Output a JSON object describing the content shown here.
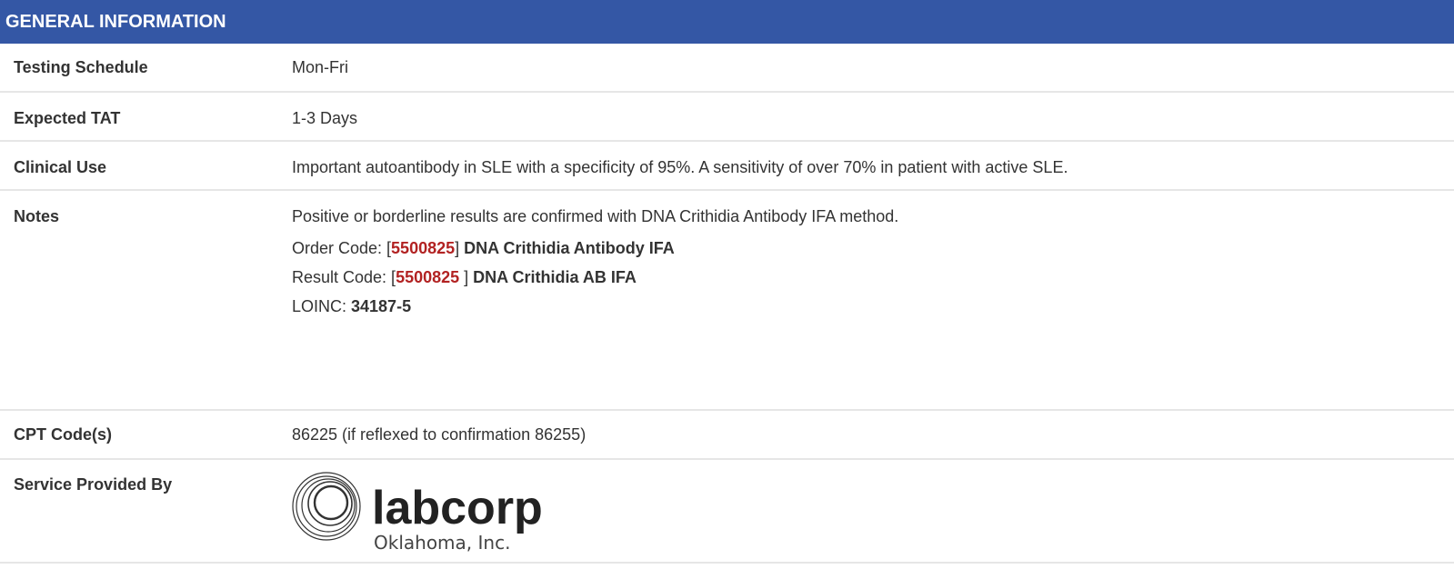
{
  "header": {
    "title": "GENERAL INFORMATION"
  },
  "rows": {
    "schedule": {
      "label": "Testing Schedule",
      "value": "Mon-Fri"
    },
    "tat": {
      "label": "Expected TAT",
      "value": "1-3 Days"
    },
    "clinical": {
      "label": "Clinical Use",
      "value": "Important autoantibody in SLE with a specificity of 95%. A sensitivity of over 70% in patient with active SLE."
    },
    "notes": {
      "label": "Notes",
      "line1": "Positive or borderline results are confirmed with DNA Crithidia Antibody IFA method.",
      "order_prefix": "Order Code: [",
      "order_code": "5500825",
      "order_suffix": "] ",
      "order_name": "DNA Crithidia Antibody IFA",
      "result_prefix": "Result Code: [",
      "result_code": "5500825",
      "result_suffix": " ] ",
      "result_name": "DNA Crithidia AB IFA",
      "loinc_prefix": "LOINC: ",
      "loinc_code": "34187-5"
    },
    "cpt": {
      "label": "CPT Code(s)",
      "value": "86225 (if reflexed to confirmation 86255)"
    },
    "provider": {
      "label": "Service Provided By",
      "logo_name": "labcorp",
      "logo_sub": "Oklahoma, Inc."
    }
  },
  "colors": {
    "header_bg": "#3457a5",
    "code_red": "#b22222",
    "divider": "#e6e6e6",
    "text": "#333333"
  }
}
